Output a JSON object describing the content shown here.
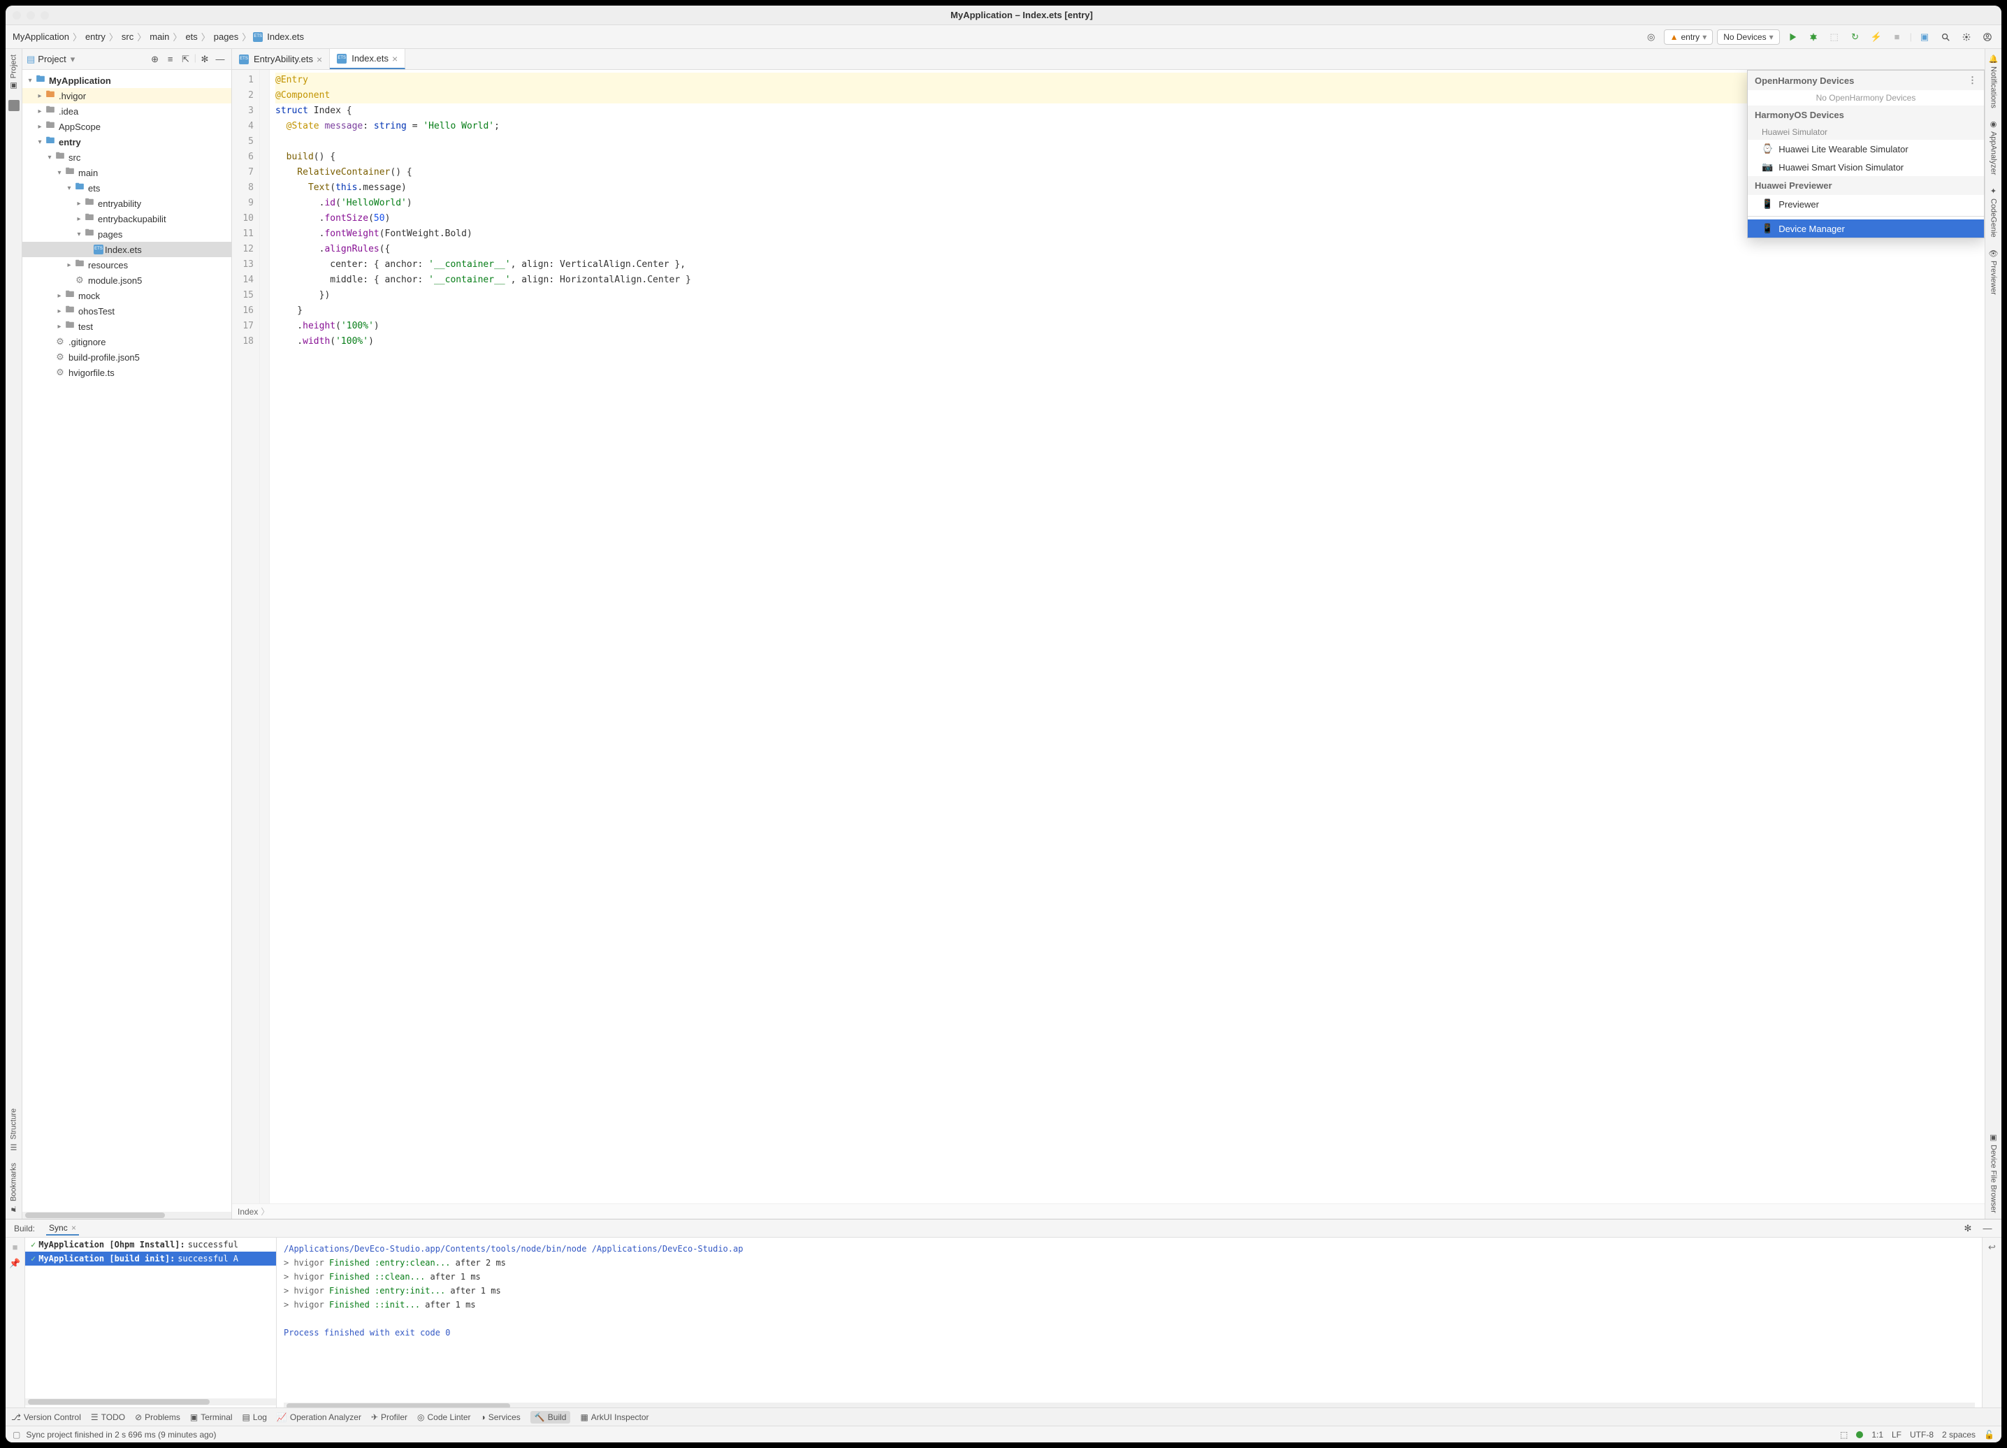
{
  "title": "MyApplication – Index.ets [entry]",
  "breadcrumb": [
    "MyApplication",
    "entry",
    "src",
    "main",
    "ets",
    "pages",
    "Index.ets"
  ],
  "runConfig": "entry",
  "deviceSelector": "No Devices",
  "projectPanel": {
    "title": "Project"
  },
  "tree": {
    "root": "MyApplication",
    "hvigor": ".hvigor",
    "idea": ".idea",
    "appscope": "AppScope",
    "entry": "entry",
    "src": "src",
    "main": "main",
    "ets": "ets",
    "entryability": "entryability",
    "entrybackup": "entrybackupabilit",
    "pages": "pages",
    "indexets": "Index.ets",
    "resources": "resources",
    "modulejson": "module.json5",
    "mock": "mock",
    "ohostest": "ohosTest",
    "test": "test",
    "gitignore": ".gitignore",
    "buildprofile": "build-profile.json5",
    "hvigorfile": "hvigorfile.ts"
  },
  "editorTabs": [
    {
      "label": "EntryAbility.ets",
      "active": false
    },
    {
      "label": "Index.ets",
      "active": true
    }
  ],
  "code": {
    "l1": "@Entry",
    "l2": "@Component",
    "l3a": "struct",
    "l3b": " Index {",
    "l4a": "  @State",
    "l4b": " message",
    "l4c": ": ",
    "l4d": "string",
    "l4e": " = ",
    "l4f": "'Hello World'",
    "l4g": ";",
    "l6a": "  build",
    "l6b": "() {",
    "l7a": "    RelativeContainer",
    "l7b": "() {",
    "l8a": "      Text",
    "l8b": "(",
    "l8c": "this",
    "l8d": ".message)",
    "l9a": "        .",
    "l9b": "id",
    "l9c": "(",
    "l9d": "'HelloWorld'",
    "l9e": ")",
    "l10a": "        .",
    "l10b": "fontSize",
    "l10c": "(",
    "l10d": "50",
    "l10e": ")",
    "l11a": "        .",
    "l11b": "fontWeight",
    "l11c": "(FontWeight.Bold)",
    "l12a": "        .",
    "l12b": "alignRules",
    "l12c": "({",
    "l13a": "          center: { anchor: ",
    "l13b": "'__container__'",
    "l13c": ", align: VerticalAlign.Center },",
    "l14a": "          middle: { anchor: ",
    "l14b": "'__container__'",
    "l14c": ", align: HorizontalAlign.Center }",
    "l15": "        })",
    "l16": "    }",
    "l17a": "    .",
    "l17b": "height",
    "l17c": "(",
    "l17d": "'100%'",
    "l17e": ")",
    "l18a": "    .",
    "l18b": "width",
    "l18c": "(",
    "l18d": "'100%'",
    "l18e": ")"
  },
  "editorBreadcrumb": "Index",
  "devicePopup": {
    "sec1": "OpenHarmony Devices",
    "sec1empty": "No OpenHarmony Devices",
    "sec2": "HarmonyOS Devices",
    "sec2sub": "Huawei Simulator",
    "dev1": "Huawei Lite Wearable Simulator",
    "dev2": "Huawei Smart Vision Simulator",
    "sec3": "Huawei Previewer",
    "dev3": "Previewer",
    "dev4": "Device Manager",
    "moreIcon": "⋮"
  },
  "buildPanel": {
    "label": "Build:",
    "tabSync": "Sync",
    "row1a": "MyApplication [Ohpm Install]:",
    "row1b": " successful",
    "row2a": "MyApplication [build init]:",
    "row2b": " successful A",
    "consolePath": "/Applications/DevEco-Studio.app/Contents/tools/node/bin/node /Applications/DevEco-Studio.ap",
    "c1a": "> hvigor ",
    "c1b": "Finished :entry:clean...",
    "c1c": " after 2 ms",
    "c2a": "> hvigor ",
    "c2b": "Finished ::clean...",
    "c2c": " after 1 ms",
    "c3a": "> hvigor ",
    "c3b": "Finished :entry:init...",
    "c3c": " after 1 ms",
    "c4a": "> hvigor ",
    "c4b": "Finished ::init...",
    "c4c": " after 1 ms",
    "cdone": "Process finished with exit code 0"
  },
  "bottomTools": {
    "vcs": "Version Control",
    "todo": "TODO",
    "problems": "Problems",
    "terminal": "Terminal",
    "log": "Log",
    "opAnalyzer": "Operation Analyzer",
    "profiler": "Profiler",
    "codeLinter": "Code Linter",
    "services": "Services",
    "build": "Build",
    "arkui": "ArkUI Inspector"
  },
  "leftStripe": {
    "project": "Project",
    "structure": "Structure",
    "bookmarks": "Bookmarks"
  },
  "rightStripe": {
    "notifications": "Notifications",
    "appAnalyzer": "AppAnalyzer",
    "codeGenie": "CodeGenie",
    "previewer": "Previewer",
    "deviceFB": "Device File Browser"
  },
  "status": {
    "left": "Sync project finished in 2 s 696 ms (9 minutes ago)",
    "pos": "1:1",
    "lf": "LF",
    "enc": "UTF-8",
    "indent": "2 spaces"
  }
}
